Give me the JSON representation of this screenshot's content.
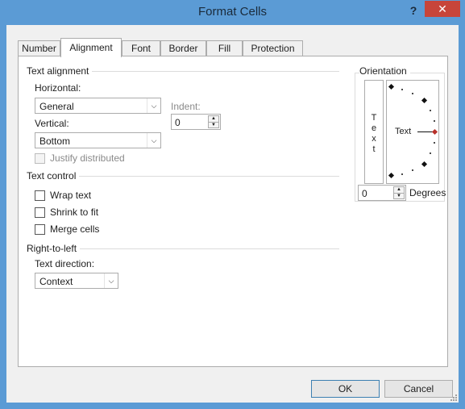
{
  "window": {
    "title": "Format Cells",
    "help_label": "?",
    "close_label": "✕"
  },
  "tabs": [
    {
      "label": "Number",
      "active": false
    },
    {
      "label": "Alignment",
      "active": true
    },
    {
      "label": "Font",
      "active": false
    },
    {
      "label": "Border",
      "active": false
    },
    {
      "label": "Fill",
      "active": false
    },
    {
      "label": "Protection",
      "active": false
    }
  ],
  "text_alignment": {
    "group_title": "Text alignment",
    "horizontal_label": "Horizontal:",
    "horizontal_value": "General",
    "vertical_label": "Vertical:",
    "vertical_value": "Bottom",
    "indent_label": "Indent:",
    "indent_value": "0",
    "justify_distributed_label": "Justify distributed"
  },
  "text_control": {
    "group_title": "Text control",
    "wrap_text_label": "Wrap text",
    "shrink_to_fit_label": "Shrink to fit",
    "merge_cells_label": "Merge cells"
  },
  "right_to_left": {
    "group_title": "Right-to-left",
    "text_direction_label": "Text direction:",
    "text_direction_value": "Context"
  },
  "orientation": {
    "group_title": "Orientation",
    "vertical_text": [
      "T",
      "e",
      "x",
      "t"
    ],
    "dial_text": "Text",
    "degrees_value": "0",
    "degrees_label": "Degrees"
  },
  "buttons": {
    "ok": "OK",
    "cancel": "Cancel"
  }
}
